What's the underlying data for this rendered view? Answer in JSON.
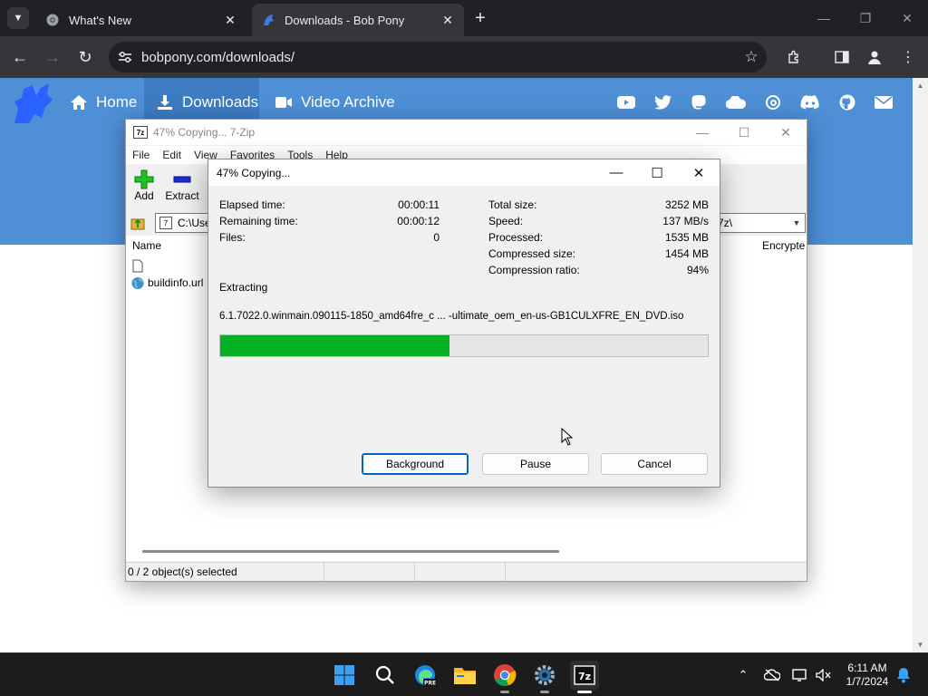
{
  "browser": {
    "tabs": [
      {
        "title": "What's New",
        "active": false
      },
      {
        "title": "Downloads - Bob Pony",
        "active": true
      }
    ],
    "url": "bobpony.com/downloads/"
  },
  "site": {
    "nav": [
      {
        "label": "Home",
        "icon": "home-icon"
      },
      {
        "label": "Downloads",
        "icon": "download-icon"
      },
      {
        "label": "Video Archive",
        "icon": "video-camera-icon"
      }
    ],
    "social_icons": [
      "youtube-icon",
      "twitter-icon",
      "mastodon-icon",
      "cloud-icon",
      "threads-icon",
      "discord-icon",
      "github-icon",
      "mail-icon"
    ],
    "hero_color": "#4e8fd6"
  },
  "sevenzip": {
    "window_title": "47% Copying... 7-Zip",
    "menu": [
      "File",
      "Edit",
      "View",
      "Favorites",
      "Tools",
      "Help"
    ],
    "toolbar": {
      "add": "Add",
      "extract": "Extract"
    },
    "path_prefix": "C:\\Use",
    "path_suffix": "7z\\",
    "columns": {
      "name": "Name",
      "encrypted": "Encrypte"
    },
    "files": [
      "",
      "buildinfo.url"
    ],
    "status": "0 / 2 object(s) selected"
  },
  "dialog": {
    "title": "47% Copying...",
    "left_stats": [
      {
        "label": "Elapsed time:",
        "value": "00:00:11"
      },
      {
        "label": "Remaining time:",
        "value": "00:00:12"
      },
      {
        "label": "Files:",
        "value": "0"
      }
    ],
    "right_stats": [
      {
        "label": "Total size:",
        "value": "3252 MB"
      },
      {
        "label": "Speed:",
        "value": "137 MB/s"
      },
      {
        "label": "Processed:",
        "value": "1535 MB"
      },
      {
        "label": "Compressed size:",
        "value": "1454 MB"
      },
      {
        "label": "Compression ratio:",
        "value": "94%"
      }
    ],
    "operation": "Extracting",
    "file_name": "6.1.7022.0.winmain.090115-1850_amd64fre_c ... -ultimate_oem_en-us-GB1CULXFRE_EN_DVD.iso",
    "progress": 0.47,
    "progress_color": "#06b025",
    "buttons": {
      "background": "Background",
      "pause": "Pause",
      "cancel": "Cancel"
    }
  },
  "taskbar": {
    "apps": [
      "windows-start-icon",
      "search-icon",
      "edge-beta-icon",
      "file-explorer-icon",
      "chrome-icon",
      "settings-icon",
      "7zip-icon"
    ],
    "time": "6:11 AM",
    "date": "1/7/2024"
  }
}
